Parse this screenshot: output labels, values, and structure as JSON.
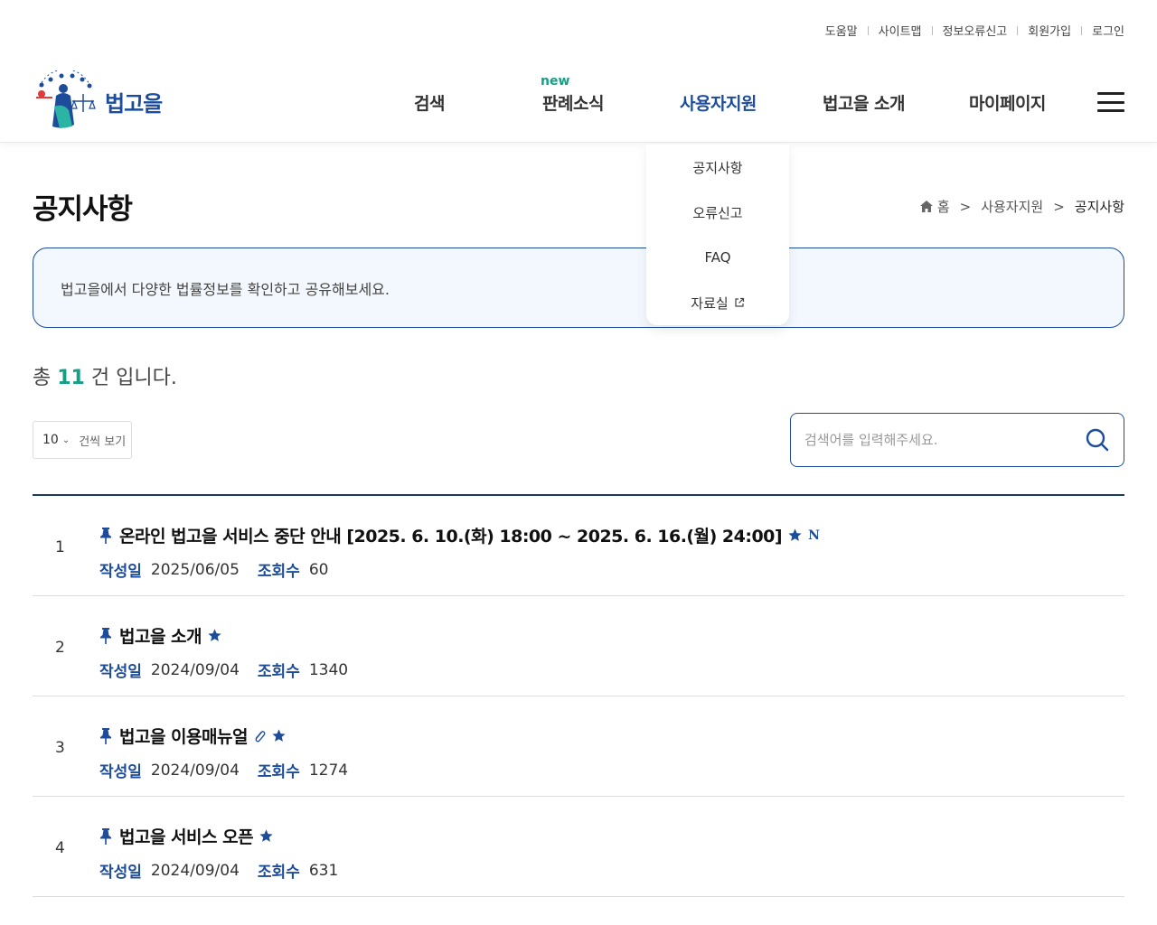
{
  "util_links": [
    "도움말",
    "사이트맵",
    "정보오류신고",
    "회원가입",
    "로그인"
  ],
  "logo": {
    "text": "법고을",
    "emblem_text": "대한민국법원"
  },
  "gnb": {
    "items": [
      {
        "label": "검색",
        "badge": ""
      },
      {
        "label": "판례소식",
        "badge": "new"
      },
      {
        "label": "사용자지원",
        "badge": ""
      },
      {
        "label": "법고을 소개",
        "badge": ""
      },
      {
        "label": "마이페이지",
        "badge": ""
      }
    ]
  },
  "dropdown": {
    "items": [
      "공지사항",
      "오류신고",
      "FAQ",
      "자료실"
    ]
  },
  "page": {
    "title": "공지사항",
    "breadcrumb": [
      "홈",
      "사용자지원",
      "공지사항"
    ],
    "info": "법고을에서 다양한 법률정보를 확인하고 공유해보세요."
  },
  "total": {
    "prefix": "총",
    "count": "11",
    "suffix": "건 입니다."
  },
  "perpage": {
    "value": "10",
    "label": "건씩 보기"
  },
  "search": {
    "placeholder": "검색어를 입력해주세요."
  },
  "meta_labels": {
    "date": "작성일",
    "views": "조회수"
  },
  "notices": [
    {
      "num": "1",
      "title": "온라인 법고을 서비스 중단 안내 [2025. 6. 10.(화) 18:00 ~ 2025. 6. 16.(월) 24:00]",
      "date": "2025/06/05",
      "views": "60",
      "important": true,
      "attachment": false,
      "is_new": true,
      "new_label": "N"
    },
    {
      "num": "2",
      "title": "법고을 소개",
      "date": "2024/09/04",
      "views": "1340",
      "important": true,
      "attachment": false,
      "is_new": false,
      "new_label": ""
    },
    {
      "num": "3",
      "title": "법고을 이용매뉴얼",
      "date": "2024/09/04",
      "views": "1274",
      "important": true,
      "attachment": true,
      "is_new": false,
      "new_label": ""
    },
    {
      "num": "4",
      "title": "법고을 서비스 오픈",
      "date": "2024/09/04",
      "views": "631",
      "important": true,
      "attachment": false,
      "is_new": false,
      "new_label": ""
    }
  ],
  "colors": {
    "primary": "#1d4c9a",
    "accent": "#14a085",
    "list_border": "#1a3a5f"
  }
}
